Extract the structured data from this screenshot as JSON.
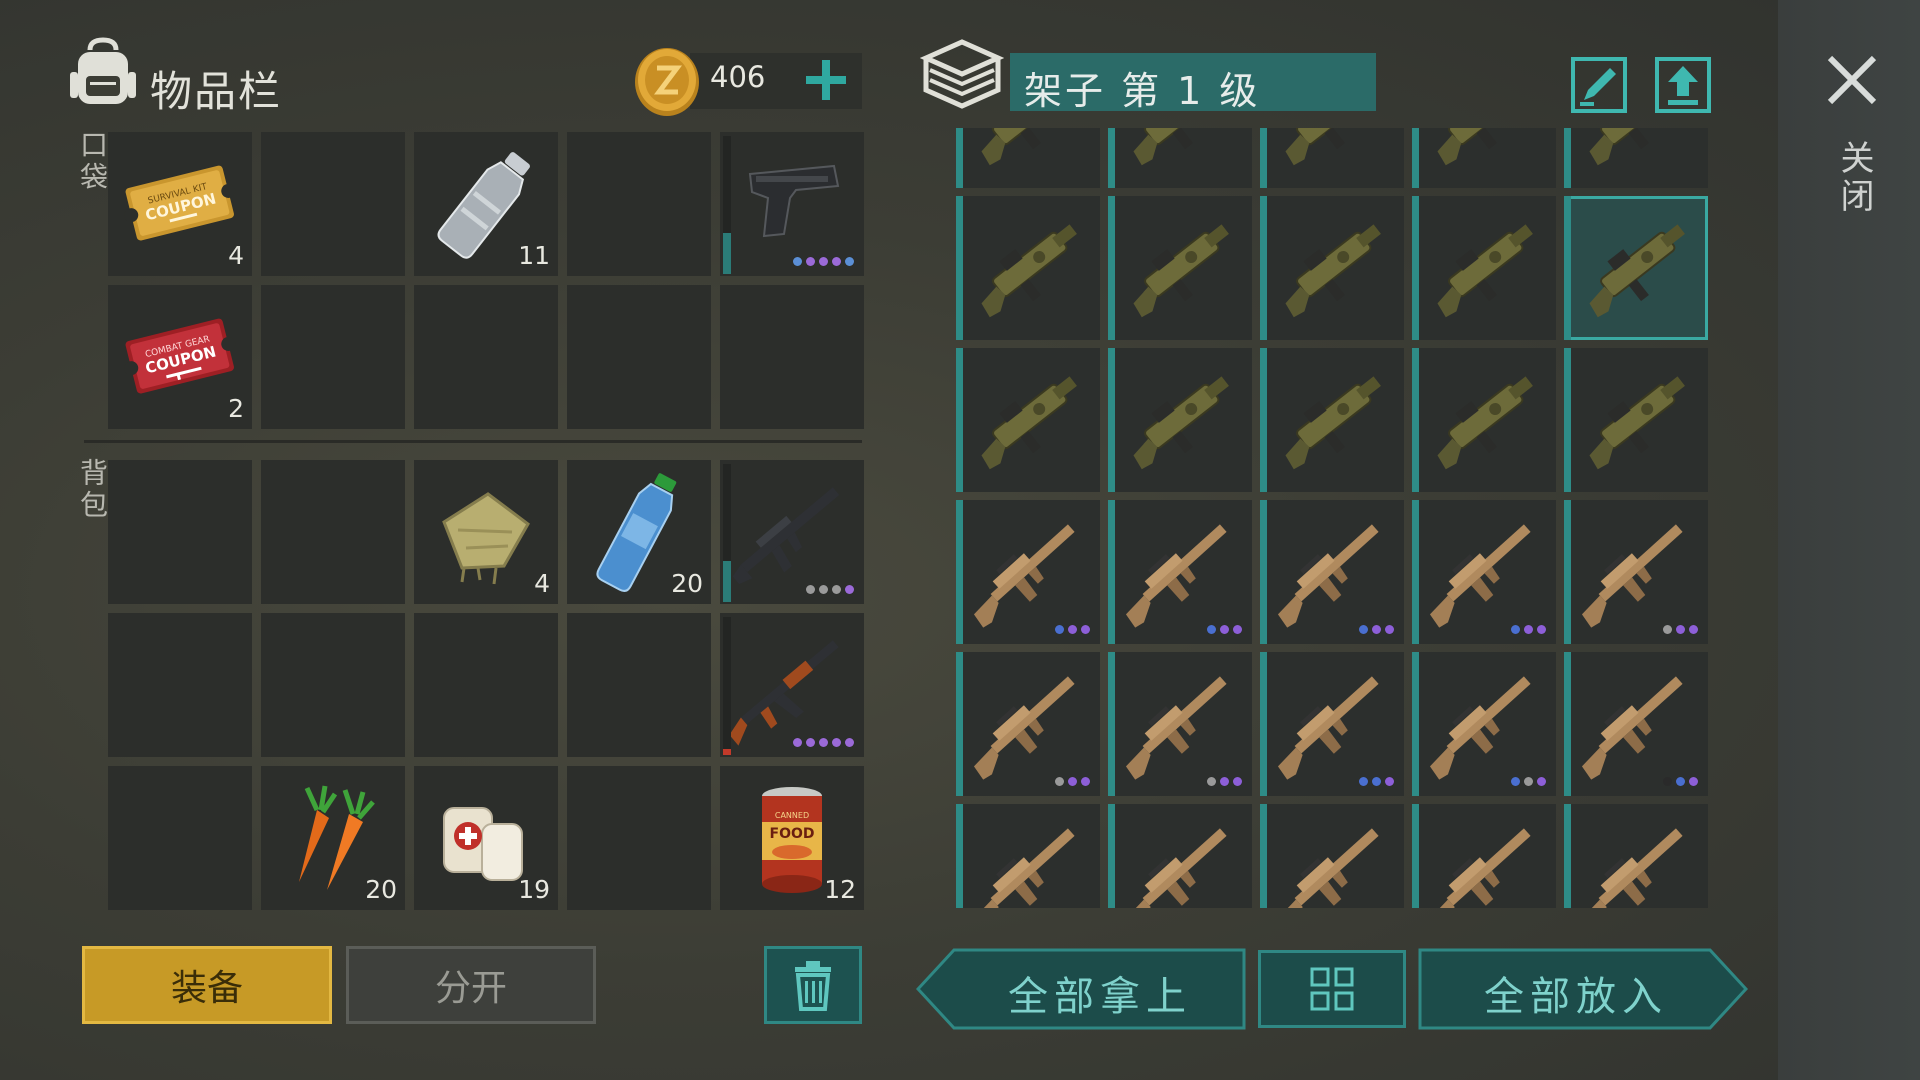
{
  "inventory": {
    "title": "物品栏",
    "pockets_label": "口袋",
    "backpack_label": "背包",
    "coins": "406",
    "pockets": [
      {
        "icon": "survival-kit-coupon-icon",
        "coupon_line1": "SURVIVAL KIT",
        "coupon_line2": "COUPON",
        "qty": "4"
      },
      {
        "icon": "empty"
      },
      {
        "icon": "plastic-bottle-icon",
        "qty": "11"
      },
      {
        "icon": "empty"
      },
      {
        "icon": "pistol-icon",
        "durability": 0.3,
        "dots": [
          "#5b8fd6",
          "#9b6ad8",
          "#9b6ad8",
          "#9b6ad8",
          "#5b8fd6"
        ]
      },
      {
        "icon": "combat-gear-coupon-icon",
        "coupon_line1": "COMBAT GEAR",
        "coupon_line2": "COUPON",
        "qty": "2"
      },
      {
        "icon": "empty"
      },
      {
        "icon": "empty"
      },
      {
        "icon": "empty"
      },
      {
        "icon": "empty"
      }
    ],
    "backpack": [
      {
        "icon": "empty"
      },
      {
        "icon": "empty"
      },
      {
        "icon": "cloth-icon",
        "qty": "4"
      },
      {
        "icon": "water-bottle-icon",
        "qty": "20"
      },
      {
        "icon": "m16-rifle-icon",
        "durability": 0.3,
        "dots": [
          "#9a9a9a",
          "#9a9a9a",
          "#9a9a9a",
          "#9b6ad8"
        ]
      },
      {
        "icon": "empty"
      },
      {
        "icon": "empty"
      },
      {
        "icon": "empty"
      },
      {
        "icon": "empty"
      },
      {
        "icon": "ak47-icon",
        "durability": 0.04,
        "dots": [
          "#9b6ad8",
          "#9b6ad8",
          "#9b6ad8",
          "#9b6ad8",
          "#9b6ad8"
        ]
      },
      {
        "icon": "empty"
      },
      {
        "icon": "carrot-icon",
        "qty": "20"
      },
      {
        "icon": "bandage-icon",
        "qty": "19"
      },
      {
        "icon": "empty"
      },
      {
        "icon": "canned-food-icon",
        "can_label_1": "CANNED",
        "can_label_2": "FOOD",
        "qty": "12"
      }
    ],
    "equip_label": "装备",
    "split_label": "分开"
  },
  "shelf": {
    "title": "架子 第 1 级",
    "close_label": "关闭",
    "take_all_label": "全部拿上",
    "put_all_label": "全部放入",
    "rows": [
      {
        "icon": "grenade-launcher-icon",
        "dots": [
          [],
          [],
          [],
          [],
          []
        ]
      },
      {
        "icon": "grenade-launcher-icon",
        "dots": [
          [],
          [],
          [],
          [],
          []
        ]
      },
      {
        "icon": "grenade-launcher-icon",
        "dots": [
          [],
          [],
          [],
          [],
          []
        ]
      },
      {
        "icon": "scar-rifle-icon",
        "dots": [
          [
            "#4a6fd0",
            "#8d5fd8",
            "#8d5fd8"
          ],
          [
            "#4a6fd0",
            "#8d5fd8",
            "#8d5fd8"
          ],
          [
            "#4a6fd0",
            "#8d5fd8",
            "#8d5fd8"
          ],
          [
            "#4a6fd0",
            "#8d5fd8",
            "#8d5fd8"
          ],
          [
            "#9a9a9a",
            "#8d5fd8",
            "#8d5fd8"
          ]
        ]
      },
      {
        "icon": "scar-rifle-icon",
        "dots": [
          [
            "#9a9a9a",
            "#8d5fd8",
            "#8d5fd8"
          ],
          [
            "#9a9a9a",
            "#8d5fd8",
            "#8d5fd8"
          ],
          [
            "#4a6fd0",
            "#4a6fd0",
            "#8d5fd8"
          ],
          [
            "#4a6fd0",
            "#9a9a9a",
            "#8d5fd8"
          ],
          [
            "#2a2a2a",
            "#4a6fd0",
            "#8d5fd8"
          ]
        ]
      },
      {
        "icon": "scar-rifle-icon",
        "dots": [
          [],
          [],
          [],
          [],
          []
        ]
      }
    ],
    "selected": {
      "row": 1,
      "col": 4
    }
  },
  "colors": {
    "accent_teal": "#2e8c87",
    "equip_gold": "#c79a26",
    "rarity_blue": "#4a6fd0",
    "rarity_purple": "#8d5fd8",
    "rarity_gray": "#9a9a9a"
  }
}
